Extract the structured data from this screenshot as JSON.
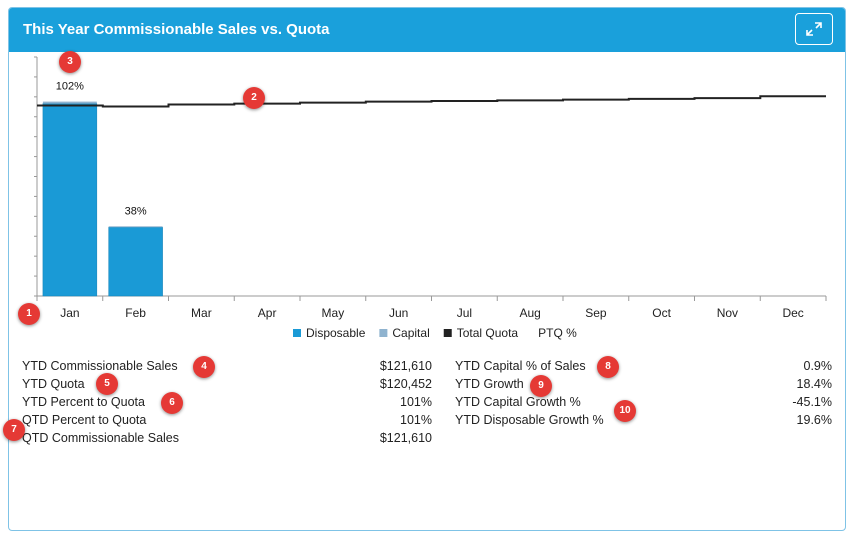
{
  "panel": {
    "title": "This Year Commissionable Sales vs. Quota"
  },
  "chart_data": {
    "type": "bar",
    "categories": [
      "Jan",
      "Feb",
      "Mar",
      "Apr",
      "May",
      "Jun",
      "Jul",
      "Aug",
      "Sep",
      "Oct",
      "Nov",
      "Dec"
    ],
    "series": [
      {
        "name": "Disposable",
        "type": "bar",
        "values": [
          98,
          35,
          null,
          null,
          null,
          null,
          null,
          null,
          null,
          null,
          null,
          null
        ],
        "color": "#1a9ad6"
      },
      {
        "name": "Capital",
        "type": "bar",
        "values": [
          1,
          0.5,
          null,
          null,
          null,
          null,
          null,
          null,
          null,
          null,
          null,
          null
        ],
        "color": "#8fb3cf"
      },
      {
        "name": "Total Quota",
        "type": "line",
        "values": [
          97,
          96.5,
          97.5,
          98,
          98.5,
          99,
          99.3,
          99.6,
          100,
          100.4,
          100.8,
          101.7
        ],
        "color": "#222222"
      }
    ],
    "data_labels": [
      "102%",
      "38%",
      "",
      "",
      "",
      "",
      "",
      "",
      "",
      "",
      "",
      ""
    ],
    "legend": [
      "Disposable",
      "Capital",
      "Total Quota",
      "PTQ %"
    ],
    "legend_position": "bottom",
    "ylim": [
      0,
      110
    ],
    "grid": false
  },
  "stats_left": [
    {
      "label": "YTD Commissionable Sales",
      "value": "$121,610"
    },
    {
      "label": "YTD Quota",
      "value": "$120,452"
    },
    {
      "label": "YTD Percent to Quota",
      "value": "101%"
    },
    {
      "label": "QTD Percent to Quota",
      "value": "101%"
    },
    {
      "label": "QTD Commissionable Sales",
      "value": "$121,610"
    }
  ],
  "stats_right": [
    {
      "label": "YTD Capital % of Sales",
      "value": "0.9%"
    },
    {
      "label": "YTD Growth",
      "value": "18.4%"
    },
    {
      "label": "YTD Capital Growth %",
      "value": "-45.1%"
    },
    {
      "label": "YTD Disposable Growth %",
      "value": "19.6%"
    }
  ],
  "markers": [
    "1",
    "2",
    "3",
    "4",
    "5",
    "6",
    "7",
    "8",
    "9",
    "10"
  ]
}
